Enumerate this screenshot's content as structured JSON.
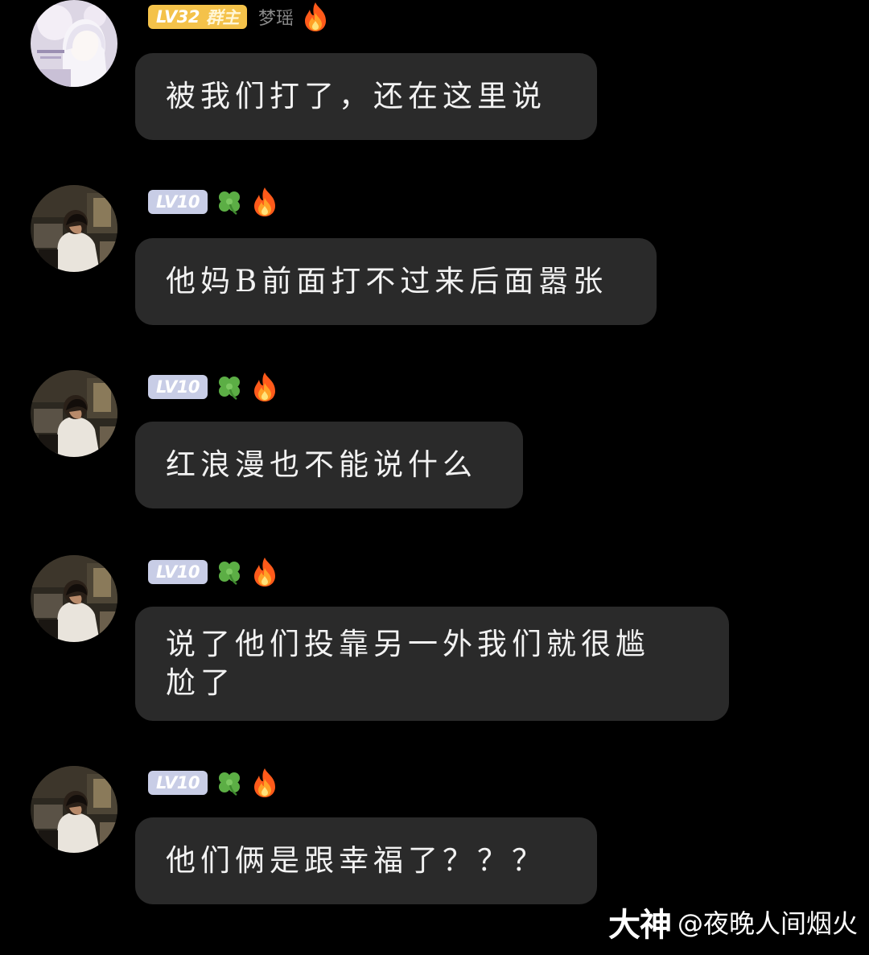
{
  "messages": [
    {
      "avatar": "anime-girl-avatar",
      "level": "LV32",
      "role": "群主",
      "username": "梦瑶",
      "badges": [
        "fire-icon"
      ],
      "text": "被我们打了，还在这里说"
    },
    {
      "avatar": "boy-photo-avatar",
      "level": "LV10",
      "role": "",
      "username": "",
      "badges": [
        "clover-icon",
        "fire-icon"
      ],
      "text": "他妈B前面打不过来后面嚣张"
    },
    {
      "avatar": "boy-photo-avatar",
      "level": "LV10",
      "role": "",
      "username": "",
      "badges": [
        "clover-icon",
        "fire-icon"
      ],
      "text": "红浪漫也不能说什么"
    },
    {
      "avatar": "boy-photo-avatar",
      "level": "LV10",
      "role": "",
      "username": "",
      "badges": [
        "clover-icon",
        "fire-icon"
      ],
      "text_lines": [
        "说了他们投靠另一外我们就很尴",
        "尬了"
      ]
    },
    {
      "avatar": "boy-photo-avatar",
      "level": "LV10",
      "role": "",
      "username": "",
      "badges": [
        "clover-icon",
        "fire-icon"
      ],
      "text": "他们俩是跟幸福了？？？"
    }
  ],
  "watermark": {
    "logo": "大神",
    "handle": "@夜晚人间烟火"
  },
  "colors": {
    "background": "#000000",
    "bubble": "#2a2a2a",
    "owner_badge": "#f4c24a",
    "level_badge": "#c8cde6"
  }
}
